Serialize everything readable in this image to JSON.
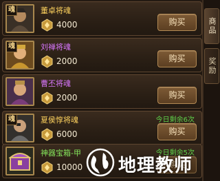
{
  "shop": {
    "items": [
      {
        "soul_tag": "魂",
        "name": "董卓将魂",
        "name_color": "gold",
        "price": "4000",
        "limit": "",
        "buy_label": "购买",
        "portrait": "dong-zhuo-portrait"
      },
      {
        "soul_tag": "魂",
        "name": "刘禅将魂",
        "name_color": "purple",
        "price": "2000",
        "limit": "",
        "buy_label": "购买",
        "portrait": "liu-shan-portrait"
      },
      {
        "soul_tag": "",
        "name": "曹丕将魂",
        "name_color": "purple",
        "price": "2000",
        "limit": "",
        "buy_label": "购买",
        "portrait": "cao-pi-portrait"
      },
      {
        "soul_tag": "魂",
        "name": "夏侯惇将魂",
        "name_color": "gold",
        "price": "6000",
        "limit": "今日剩余6次",
        "buy_label": "购买",
        "portrait": "xiahou-dun-portrait"
      },
      {
        "soul_tag": "",
        "name": "神器宝箱-甲",
        "name_color": "green",
        "price": "10000",
        "limit": "今日剩余5次",
        "buy_label": "购买",
        "portrait": "treasure-chest-portrait"
      }
    ]
  },
  "tabs": [
    {
      "label": "商品",
      "active": true
    },
    {
      "label": "奖励",
      "active": false
    }
  ],
  "watermark": {
    "text": "地理教师",
    "icon": "globe-icon"
  },
  "colors": {
    "gold": "#ffd35e",
    "purple": "#d977ff",
    "green": "#84e35b",
    "limit": "#5fd24a"
  }
}
